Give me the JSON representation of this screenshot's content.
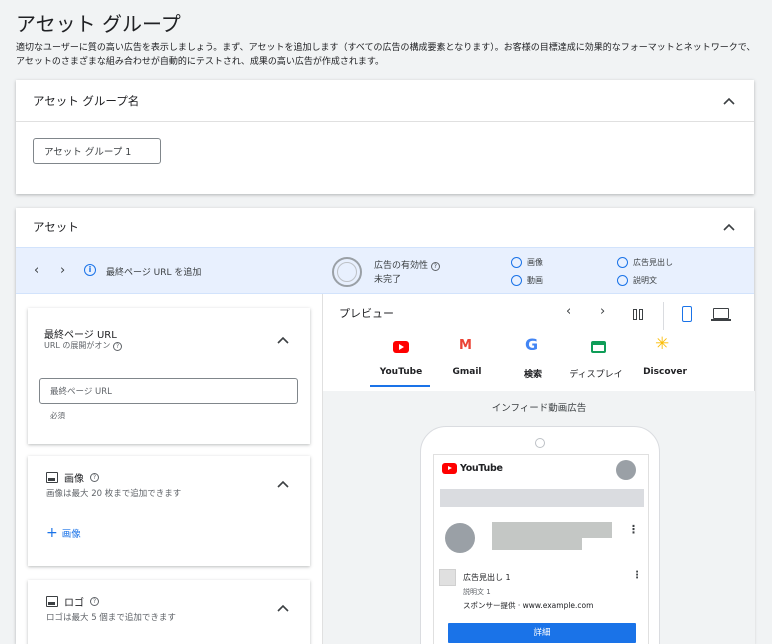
{
  "page": {
    "title": "アセット グループ",
    "description": "適切なユーザーに質の高い広告を表示しましょう。まず、アセットを追加します（すべての広告の構成要素となります）。お客様の目標達成に効果的なフォーマットとネットワークで、アセットのさまざまな組み合わせが自動的にテストされ、成果の高い広告が作成されます。"
  },
  "asset_group_name": {
    "header": "アセット グループ名",
    "value": "アセット グループ 1"
  },
  "assets": {
    "header": "アセット",
    "toolbar": {
      "add_final_url": "最終ページ URL を追加",
      "ad_strength_label": "広告の有効性",
      "ad_strength_value": "未完了",
      "checks": [
        "画像",
        "広告見出し",
        "動画",
        "説明文"
      ]
    },
    "final_url": {
      "title": "最終ページ URL",
      "subtitle": "URL の展開がオン",
      "placeholder": "最終ページ URL",
      "helper": "必須"
    },
    "image": {
      "title": "画像",
      "subtitle": "画像は最大 20 枚まで追加できます",
      "add": "画像"
    },
    "logo": {
      "title": "ロゴ",
      "subtitle": "ロゴは最大 5 個まで追加できます"
    }
  },
  "preview": {
    "title": "プレビュー",
    "tabs": [
      "YouTube",
      "Gmail",
      "検索",
      "ディスプレイ",
      "Discover"
    ],
    "selected_tab": "YouTube",
    "format_label": "インフィード動画広告",
    "phone": {
      "brand": "YouTube",
      "headline": "広告見出し 1",
      "description": "説明文 1",
      "sponsor": "スポンサー提供 · www.example.com",
      "cta": "詳細"
    }
  },
  "colors": {
    "accent": "#1a73e8",
    "youtube": "#ff0000",
    "toolbar_bg": "#e8f0fe"
  }
}
